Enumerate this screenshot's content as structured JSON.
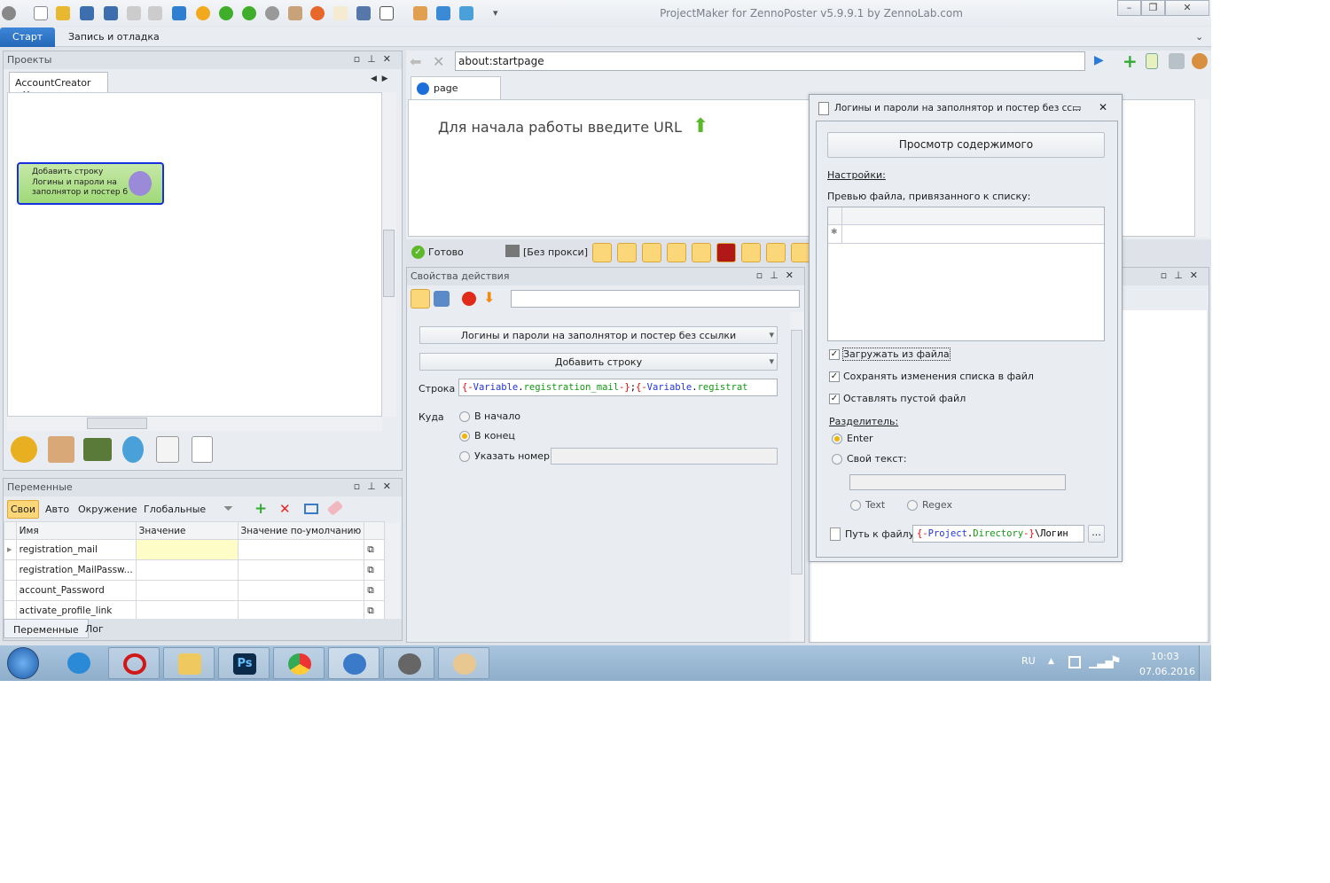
{
  "window": {
    "title": "ProjectMaker for ZennoPoster v5.9.9.1 by ZennoLab.com",
    "buttons": [
      "minimize",
      "restore",
      "close"
    ]
  },
  "ribbon": {
    "tabs": [
      {
        "label": "Старт",
        "active": true
      },
      {
        "label": "Запись и отладка",
        "active": false
      }
    ]
  },
  "projects": {
    "title": "Проекты",
    "tab": "AccountCreator",
    "node": {
      "line1": "Добавить строку",
      "line2": "Логины и пароли на",
      "line3": "заполнятор  и постер б"
    }
  },
  "variables": {
    "title": "Переменные",
    "filters": [
      "Свои",
      "Авто",
      "Окружение",
      "Глобальные"
    ],
    "active_filter": "Свои",
    "columns": [
      "Имя",
      "Значение",
      "Значение по-умолчанию"
    ],
    "rows": [
      {
        "name": "registration_mail",
        "value": "",
        "default": ""
      },
      {
        "name": "registration_MailPassw...",
        "value": "",
        "default": ""
      },
      {
        "name": "account_Password",
        "value": "",
        "default": ""
      },
      {
        "name": "activate_profile_link",
        "value": "",
        "default": ""
      }
    ],
    "bottom_tabs": [
      "Переменные",
      "Лог"
    ]
  },
  "browser": {
    "url": "about:startpage",
    "tab": "page",
    "start_text": "Для начала работы введите URL",
    "status": "Готово",
    "proxy": "[Без прокси]"
  },
  "action_props": {
    "title": "Свойства действия",
    "list_select": "Логины и пароли на заполнятор и постер без ссылки",
    "action_select": "Добавить строку",
    "string_label": "Строка",
    "string_value": {
      "p1": "{-",
      "p2": "Variable",
      "p3": ".",
      "p4": "registration_mail",
      "p5": "-}",
      ";": ";",
      "p6": "{-",
      "p7": "Variable",
      "p8": ".",
      "p9": "registrat"
    },
    "where_label": "Куда",
    "options": [
      "В начало",
      "В конец",
      "Указать номер"
    ],
    "selected": "В конец"
  },
  "dialog": {
    "title": "Логины и пароли на заполнятор и постер без сс...",
    "view_button": "Просмотр содержимого",
    "settings_label": "Настройки:",
    "preview_label": "Превью файла, привязанного к списку:",
    "checks": [
      {
        "label": "Загружать из файла",
        "checked": true
      },
      {
        "label": "Сохранять изменения списка в файл",
        "checked": true
      },
      {
        "label": "Оставлять пустой файл",
        "checked": true
      }
    ],
    "separator_label": "Разделитель:",
    "sep_options": [
      "Enter",
      "Свой текст:"
    ],
    "sep_selected": "Enter",
    "mode_options": [
      "Text",
      "Regex"
    ],
    "path_label": "Путь к файлу",
    "path_value": {
      "p1": "{-",
      "p2": "Project",
      "p3": ".",
      "p4": "Directory",
      "p5": "-}",
      "p6": "\\Логин"
    },
    "browse": "..."
  },
  "taskbar": {
    "lang": "RU",
    "time": "10:03",
    "date": "07.06.2016"
  }
}
